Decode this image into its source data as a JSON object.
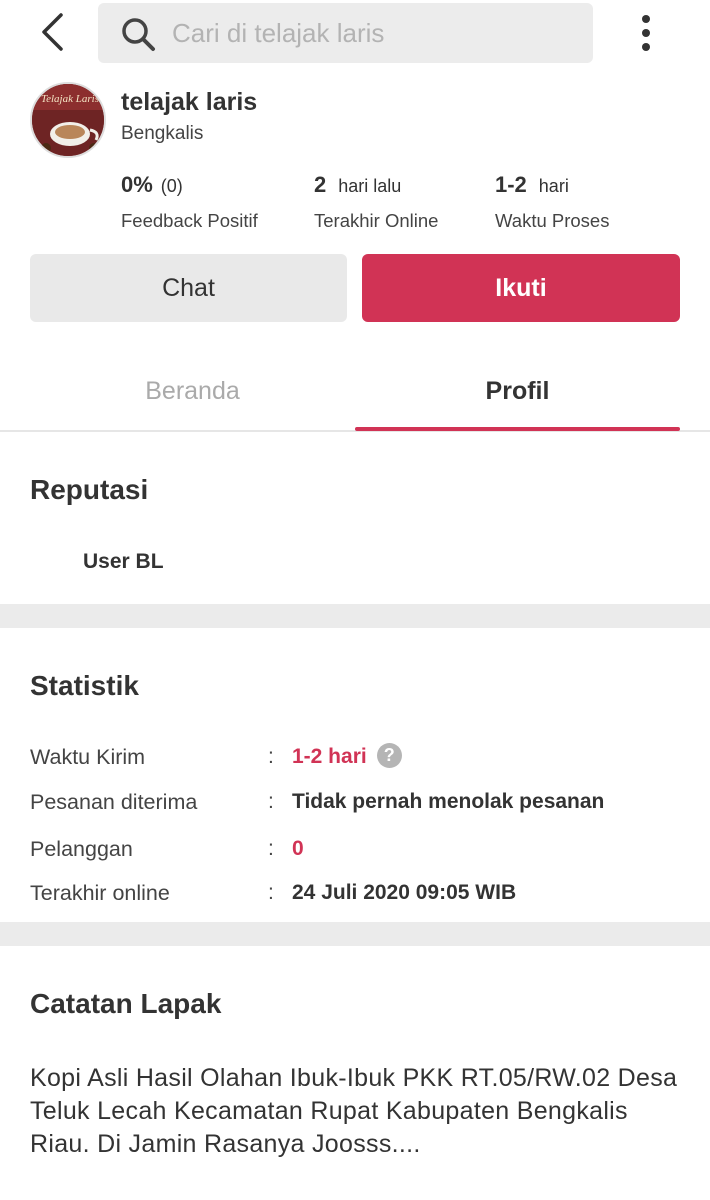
{
  "search": {
    "placeholder": "Cari di telajak laris"
  },
  "store": {
    "name": "telajak laris",
    "city": "Bengkalis",
    "avatar_text": "Telajak Laris"
  },
  "stats": [
    {
      "value": "0%",
      "sub": "(0)",
      "label": "Feedback Positif"
    },
    {
      "value": "2",
      "sub": "hari lalu",
      "label": "Terakhir Online"
    },
    {
      "value": "1-2",
      "sub": "hari",
      "label": "Waktu Proses"
    }
  ],
  "actions": {
    "chat": "Chat",
    "follow": "Ikuti"
  },
  "tabs": {
    "home": "Beranda",
    "profile": "Profil"
  },
  "reputation": {
    "title": "Reputasi",
    "user": "User BL"
  },
  "statistics": {
    "title": "Statistik",
    "rows": [
      {
        "key": "Waktu Kirim",
        "value": "1-2 hari"
      },
      {
        "key": "Pesanan diterima",
        "value": "Tidak pernah menolak pesanan"
      },
      {
        "key": "Pelanggan",
        "value": "0"
      },
      {
        "key": "Terakhir online",
        "value": "24 Juli 2020 09:05 WIB"
      }
    ],
    "help_glyph": "?"
  },
  "notes": {
    "title": "Catatan Lapak",
    "text": "Kopi Asli Hasil Olahan Ibuk-Ibuk PKK RT.05/RW.02 Desa Teluk Lecah Kecamatan Rupat Kabupaten Bengkalis Riau. Di Jamin Rasanya Joosss...."
  },
  "colors": {
    "accent": "#d13355",
    "muted": "#aaaaaa",
    "divider": "#ebebeb"
  }
}
